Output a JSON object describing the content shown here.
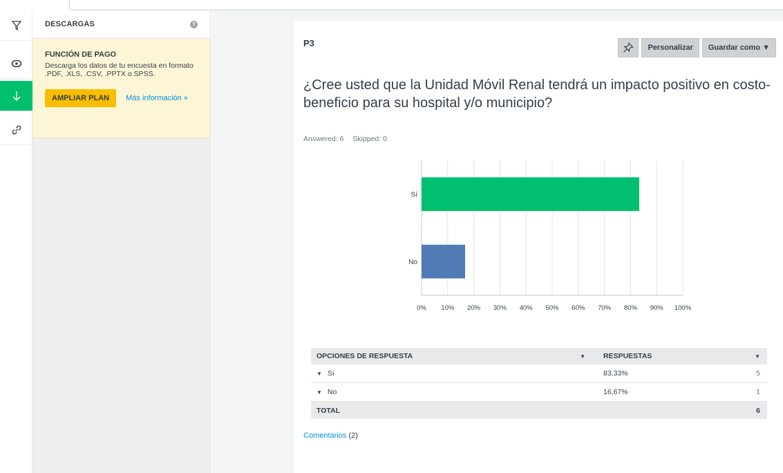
{
  "panel": {
    "title": "DESCARGAS",
    "help": "?",
    "promo_title": "FUNCIÓN DE PAGO",
    "promo_text": "Descarga los datos de tu encuesta en formato .PDF, .XLS, .CSV, .PPTX o SPSS.",
    "upgrade_label": "AMPLIAR PLAN",
    "more_info_label": "Más información »"
  },
  "rail": {
    "items": [
      "filter-icon",
      "eye-icon",
      "download-icon",
      "link-icon"
    ],
    "active_color": "#00bf6f"
  },
  "card": {
    "question_label": "P3",
    "question": "¿Cree usted que la Unidad Móvil Renal tendrá un impacto positivo en costo-beneficio para su hospital y/o municipio?",
    "answered": "Answered: 6",
    "skipped": "Skipped: 0",
    "customize_label": "Personalizar",
    "save_as_label": "Guardar como ▼"
  },
  "chart_data": {
    "type": "bar",
    "orientation": "horizontal",
    "categories": [
      "Sí",
      "No"
    ],
    "values": [
      83.33,
      16.67
    ],
    "colors": [
      "#00bf6f",
      "#507cb6"
    ],
    "xticks": [
      "0%",
      "10%",
      "20%",
      "30%",
      "40%",
      "50%",
      "60%",
      "70%",
      "80%",
      "90%",
      "100%"
    ],
    "xlim": [
      0,
      100
    ],
    "grid": true
  },
  "table": {
    "headers": [
      "OPCIONES DE RESPUESTA",
      "RESPUESTAS"
    ],
    "rows": [
      {
        "label": "Sí",
        "percent": "83,33%",
        "count": "5"
      },
      {
        "label": "No",
        "percent": "16,67%",
        "count": "1"
      }
    ],
    "total_label": "TOTAL",
    "total_count": "6"
  },
  "comments": {
    "label": "Comentarios",
    "count": "(2)"
  }
}
